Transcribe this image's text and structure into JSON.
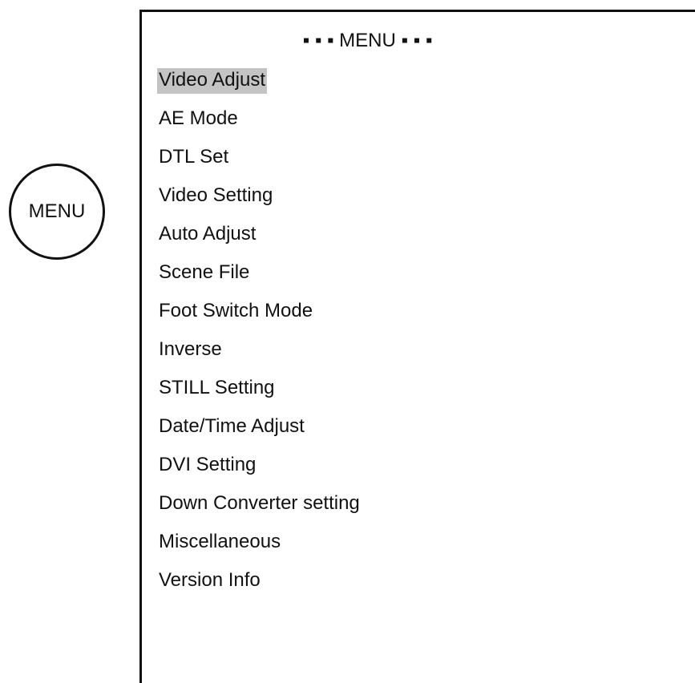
{
  "menu_button": {
    "label": "MENU"
  },
  "menu": {
    "header": "▪ ▪ ▪ MENU ▪ ▪ ▪",
    "selected_index": 0,
    "items": [
      {
        "label": "Video Adjust"
      },
      {
        "label": "AE Mode"
      },
      {
        "label": "DTL Set"
      },
      {
        "label": "Video Setting"
      },
      {
        "label": "Auto Adjust"
      },
      {
        "label": "Scene File"
      },
      {
        "label": "Foot Switch Mode"
      },
      {
        "label": "Inverse"
      },
      {
        "label": "STILL Setting"
      },
      {
        "label": "Date/Time Adjust"
      },
      {
        "label": "DVI Setting"
      },
      {
        "label": "Down Converter setting"
      },
      {
        "label": "Miscellaneous"
      },
      {
        "label": "Version Info"
      }
    ]
  },
  "colors": {
    "highlight": "#c4c4c4",
    "border": "#111111",
    "background": "#ffffff"
  }
}
